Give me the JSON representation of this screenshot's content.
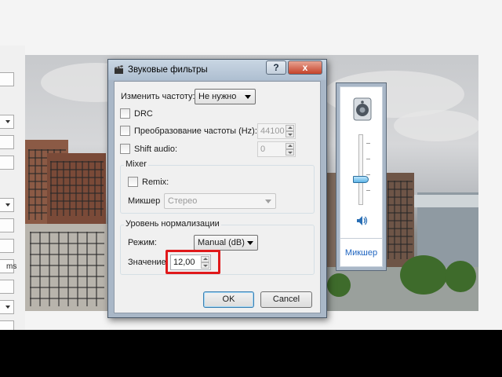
{
  "dialog": {
    "title": "Звуковые фильтры",
    "help_label": "?",
    "close_label": "x",
    "change_rate_label": "Изменить частоту:",
    "change_rate_value": "Не нужно",
    "drc_label": "DRC",
    "resample_label": "Преобразование частоты (Hz):",
    "resample_value": "44100",
    "shift_label": "Shift audio:",
    "shift_value": "0",
    "mixer_group": {
      "title": "Mixer",
      "remix_label": "Remix:",
      "mixer_label": "Микшер",
      "mixer_value": "Стерео"
    },
    "normalize_group": {
      "title": "Уровень нормализации",
      "mode_label": "Режим:",
      "mode_value": "Manual (dB)",
      "value_label": "Значение",
      "value": "12,00"
    },
    "ok_label": "OK",
    "cancel_label": "Cancel"
  },
  "mixer_panel": {
    "label": "Микшер",
    "volume_fraction": 0.35
  },
  "host": {
    "units_label": "ms"
  },
  "colors": {
    "highlight": "#e0191b",
    "link": "#1e64c0",
    "frame": "#a9b7c7"
  },
  "icons": {
    "dialog_title": "clapperboard-icon",
    "speaker_device": "speaker-device-icon",
    "volume": "speaker-volume-icon"
  }
}
